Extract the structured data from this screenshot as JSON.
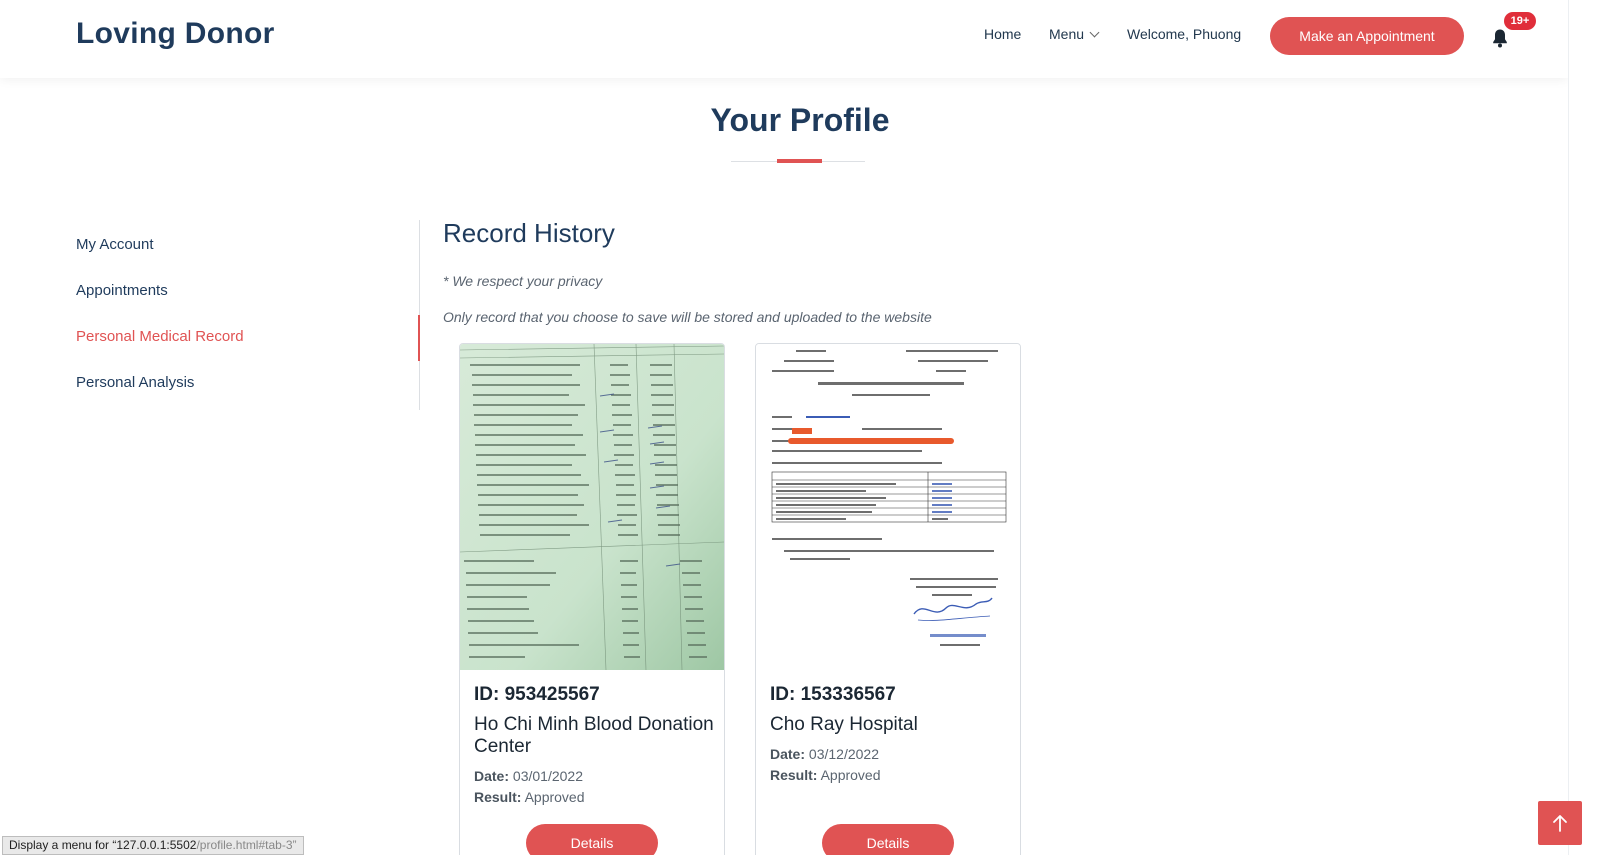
{
  "header": {
    "logo": "Loving Donor",
    "nav": {
      "home": "Home",
      "menu": "Menu",
      "welcome": "Welcome, Phuong"
    },
    "appointment_button": "Make an Appointment",
    "notification_badge": "19+"
  },
  "page": {
    "title": "Your Profile"
  },
  "sidebar": {
    "items": [
      {
        "label": "My Account",
        "active": false
      },
      {
        "label": "Appointments",
        "active": false
      },
      {
        "label": "Personal Medical Record",
        "active": true
      },
      {
        "label": "Personal Analysis",
        "active": false
      }
    ]
  },
  "main": {
    "section_title": "Record History",
    "privacy_note": "* We respect your privacy",
    "privacy_detail": "Only record that you choose to save will be stored and uploaded to the website",
    "records": [
      {
        "id_label": "ID:",
        "id": "953425567",
        "center": "Ho Chi Minh Blood Donation Center",
        "date_label": "Date:",
        "date": "03/01/2022",
        "result_label": "Result:",
        "result": "Approved",
        "button": "Details"
      },
      {
        "id_label": "ID:",
        "id": "153336567",
        "center": "Cho Ray Hospital",
        "date_label": "Date:",
        "date": "03/12/2022",
        "result_label": "Result:",
        "result": "Approved",
        "button": "Details"
      }
    ]
  },
  "statusbar": {
    "prefix": "Display a menu for “127.0.0.1:5502",
    "suffix": "/profile.html#tab-3”"
  },
  "colors": {
    "accent": "#e05353",
    "navy": "#1f3b5c"
  }
}
